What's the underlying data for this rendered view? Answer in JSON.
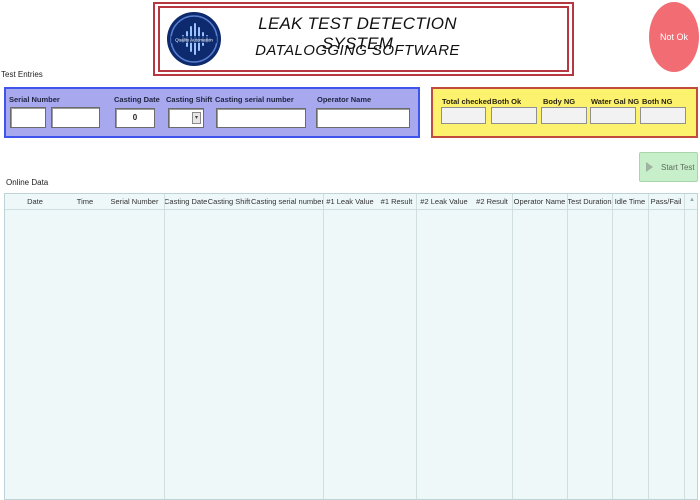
{
  "header": {
    "title_line1": "LEAK TEST DETECTION SYSTEM",
    "title_line2": "DATALOGGING SOFTWARE",
    "logo_text": "Quality Automation"
  },
  "status": {
    "label": "Not Ok",
    "color": "#f26d73"
  },
  "entries": {
    "section_label": "Test Entries",
    "serial_number": {
      "label": "Serial Number",
      "value_a": "",
      "value_b": ""
    },
    "casting_date": {
      "label": "Casting Date",
      "value": "0"
    },
    "casting_shift": {
      "label": "Casting Shift",
      "value": ""
    },
    "casting_serial": {
      "label": "Casting serial number",
      "value": ""
    },
    "operator_name": {
      "label": "Operator Name",
      "value": ""
    }
  },
  "summary": {
    "total_checked": {
      "label": "Total checked",
      "value": ""
    },
    "both_ok": {
      "label": "Both Ok",
      "value": ""
    },
    "body_ng": {
      "label": "Body NG",
      "value": ""
    },
    "water_gal_ng": {
      "label": "Water Gal NG",
      "value": ""
    },
    "both_ng": {
      "label": "Both NG",
      "value": ""
    }
  },
  "start_button": {
    "label": "Start Test"
  },
  "online": {
    "section_label": "Online Data",
    "columns": [
      "Date",
      "Time",
      "Serial Number",
      "Casting  Date",
      "Casting Shift",
      "Casting serial number",
      "#1 Leak Value",
      "#1 Result",
      "#2 Leak Value",
      "#2 Result",
      "Operator Name",
      "Test Duration",
      "Idle Time",
      "Pass/Fail"
    ]
  },
  "colors": {
    "entries_bg": "#a7a8ed",
    "entries_border": "#3f54ea",
    "summary_bg": "#fdf26e",
    "summary_border": "#c14b3d",
    "header_border": "#b5373f",
    "start_button_bg": "#c7efc9",
    "table_bg": "#eef8f9"
  }
}
